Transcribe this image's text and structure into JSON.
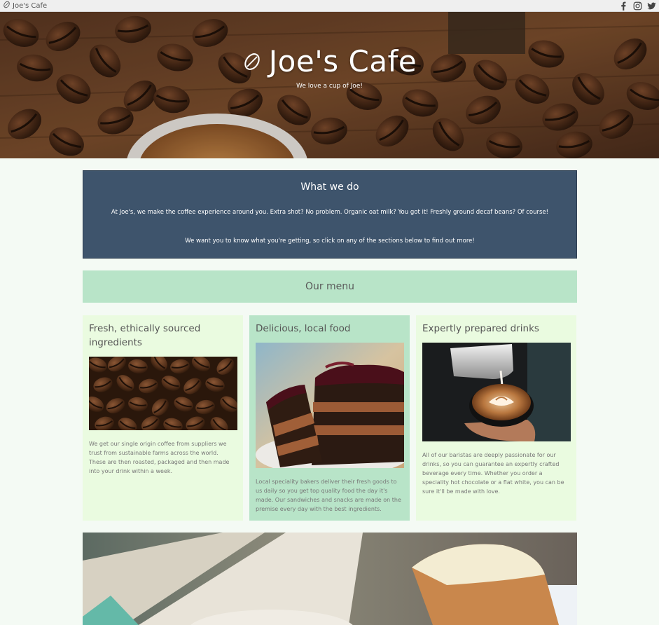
{
  "topbar": {
    "brand": "Joe's Cafe",
    "social": [
      "facebook-icon",
      "instagram-icon",
      "twitter-icon"
    ]
  },
  "hero": {
    "title": "Joe's Cafe",
    "subtitle": "We love a cup of Joe!"
  },
  "what_we_do": {
    "heading": "What we do",
    "paragraph1": "At Joe's, we make the coffee experience around you. Extra shot? No problem. Organic oat milk? You got it! Freshly ground decaf beans? Of course!",
    "paragraph2": "We want you to know what you're getting, so click on any of the sections below to find out more!"
  },
  "menu": {
    "title": "Our menu",
    "cards": [
      {
        "title": "Fresh, ethically sourced ingredients",
        "text": "We get our single origin coffee from suppliers we trust from sustainable farms across the world. These are then roasted, packaged and then made into your drink within a week."
      },
      {
        "title": "Delicious, local food",
        "text": "Local speciality bakers deliver their fresh goods to us daily so you get top quality food the day it's made. Our sandwiches and snacks are made on the premise every day with the best ingredients."
      },
      {
        "title": "Expertly prepared drinks",
        "text": "All of our baristas are deeply passionate for our drinks, so you can guarantee an expertly crafted beverage every time. Whether you order a speciality hot chocolate or a flat white, you can be sure it'll be made with love."
      }
    ]
  },
  "colors": {
    "what_we_do_bg": "#3e546c",
    "menu_band_bg": "#b8e4c8",
    "card_light_bg": "#eafbe0",
    "page_bg": "#f4faf4"
  }
}
